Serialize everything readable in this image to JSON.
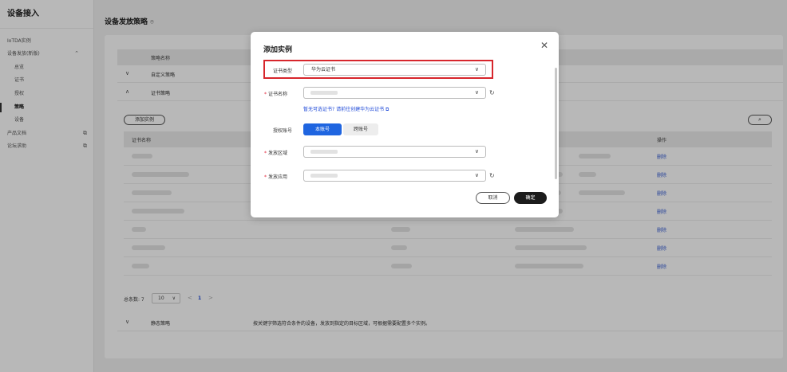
{
  "sidebar": {
    "title": "设备接入",
    "items": [
      {
        "label": "IoTDA实例"
      },
      {
        "label": "设备发放(新版)",
        "toggle": "⌃"
      },
      {
        "label": "总览"
      },
      {
        "label": "证书"
      },
      {
        "label": "授权"
      },
      {
        "label": "策略"
      },
      {
        "label": "设备"
      },
      {
        "label": "产品文档",
        "ext": "⧉"
      },
      {
        "label": "论坛求助",
        "ext": "⧉"
      }
    ]
  },
  "page": {
    "title": "设备发放策略",
    "help_glyph": "⍟"
  },
  "policy_table": {
    "header": "策略名称",
    "rows": [
      {
        "chev": "∨",
        "name": "自定义策略"
      },
      {
        "chev": "∧",
        "name": "证书策略"
      }
    ]
  },
  "instances": {
    "add_button": "添加实例",
    "search_glyph": "⌕",
    "col_cert_name": "证书名称",
    "col_actions": "操作",
    "delete_label": "删除",
    "row_count": 7
  },
  "pager": {
    "total": "总条数: 7",
    "size": "10",
    "prev": "<",
    "page": "1",
    "next": ">"
  },
  "static_policy": {
    "chev": "∨",
    "name": "静态策略",
    "desc": "按关键字筛选符合条件的设备，发放到指定的目标区域，可根据需要配置多个实例。"
  },
  "modal": {
    "title": "添加实例",
    "close": "✕",
    "cert_type_label": "证书类型",
    "cert_type_value": "华为云证书",
    "cert_name_label": "证书名称",
    "no_cert_hint": "暂无可选证书? 请前往创建华为云证书 ⧉",
    "auth_account_label": "授权账号",
    "auth_this": "本账号",
    "auth_cross": "跨账号",
    "region_label": "发放区域",
    "app_label": "发放应用",
    "cancel": "取消",
    "confirm": "确定"
  }
}
